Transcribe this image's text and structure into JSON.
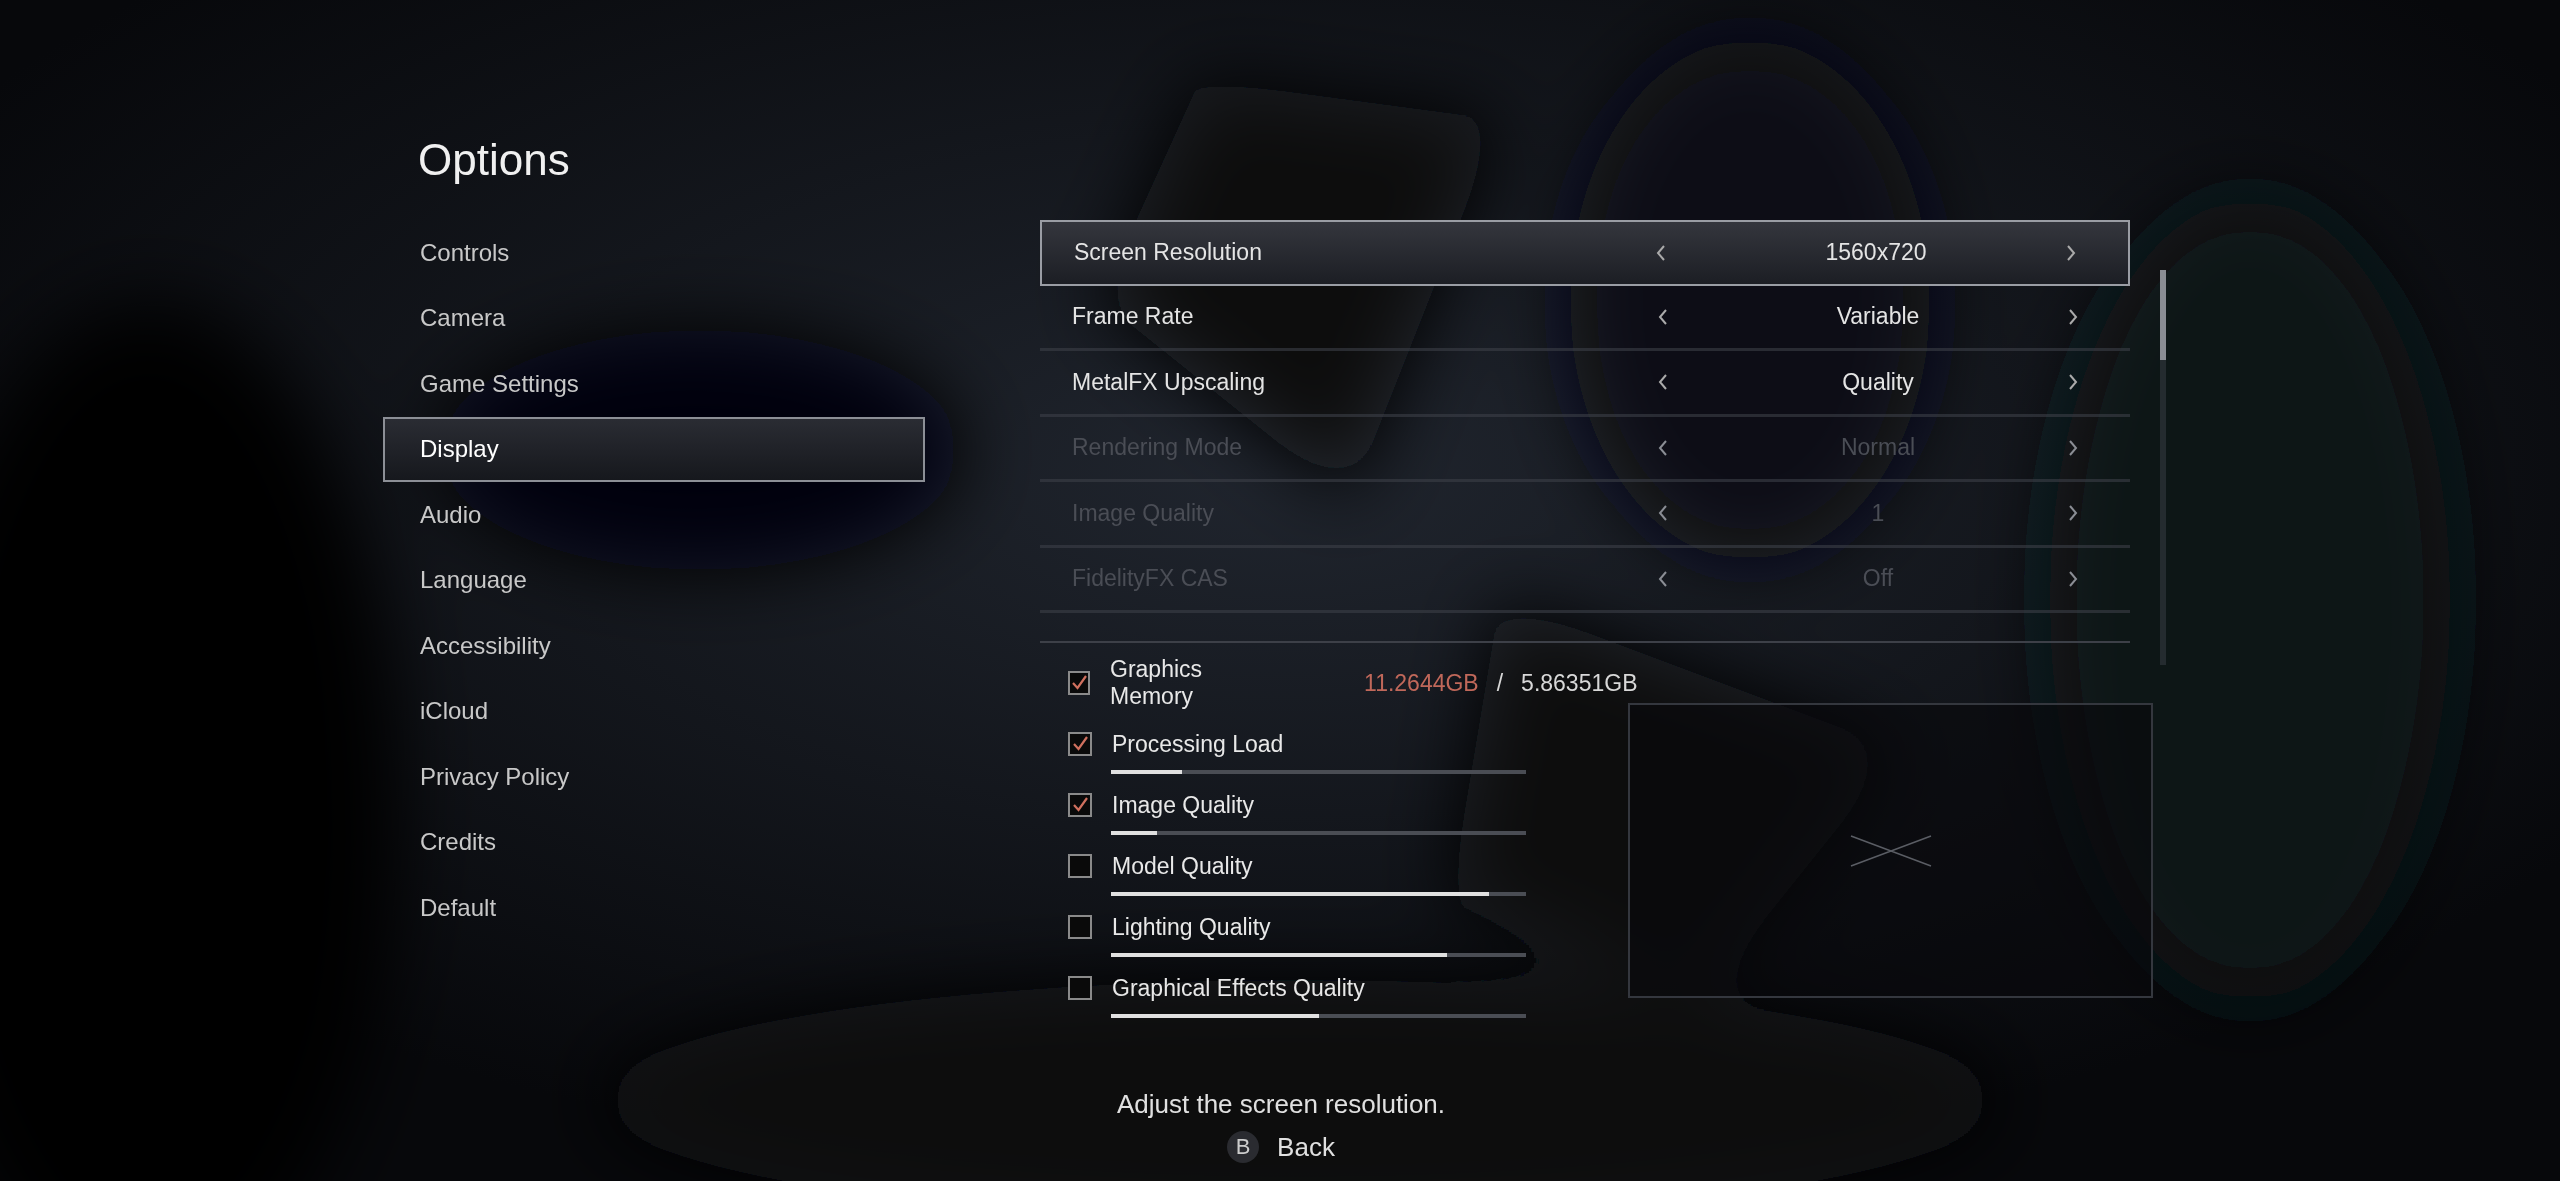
{
  "title": "Options",
  "menu": [
    {
      "label": "Controls",
      "selected": false
    },
    {
      "label": "Camera",
      "selected": false
    },
    {
      "label": "Game Settings",
      "selected": false
    },
    {
      "label": "Display",
      "selected": true
    },
    {
      "label": "Audio",
      "selected": false
    },
    {
      "label": "Language",
      "selected": false
    },
    {
      "label": "Accessibility",
      "selected": false
    },
    {
      "label": "iCloud",
      "selected": false
    },
    {
      "label": "Privacy Policy",
      "selected": false
    },
    {
      "label": "Credits",
      "selected": false
    },
    {
      "label": "Default",
      "selected": false
    }
  ],
  "settings": [
    {
      "label": "Screen Resolution",
      "value": "1560x720",
      "selected": true,
      "disabled": false
    },
    {
      "label": "Frame Rate",
      "value": "Variable",
      "selected": false,
      "disabled": false
    },
    {
      "label": "MetalFX Upscaling",
      "value": "Quality",
      "selected": false,
      "disabled": false
    },
    {
      "label": "Rendering Mode",
      "value": "Normal",
      "selected": false,
      "disabled": true
    },
    {
      "label": "Image Quality",
      "value": "1",
      "selected": false,
      "disabled": true
    },
    {
      "label": "FidelityFX CAS",
      "value": "Off",
      "selected": false,
      "disabled": true
    }
  ],
  "memory": {
    "label": "Graphics Memory",
    "checked": true,
    "used": "11.2644GB",
    "separator": "/",
    "total": "5.86351GB"
  },
  "meters": [
    {
      "label": "Processing Load",
      "checked": true,
      "level": 0.17
    },
    {
      "label": "Image Quality",
      "checked": true,
      "level": 0.11
    },
    {
      "label": "Model Quality",
      "checked": false,
      "level": 0.91
    },
    {
      "label": "Lighting Quality",
      "checked": false,
      "level": 0.81
    },
    {
      "label": "Graphical Effects Quality",
      "checked": false,
      "level": 0.5
    }
  ],
  "help": "Adjust the screen resolution.",
  "back": {
    "key": "B",
    "label": "Back"
  }
}
